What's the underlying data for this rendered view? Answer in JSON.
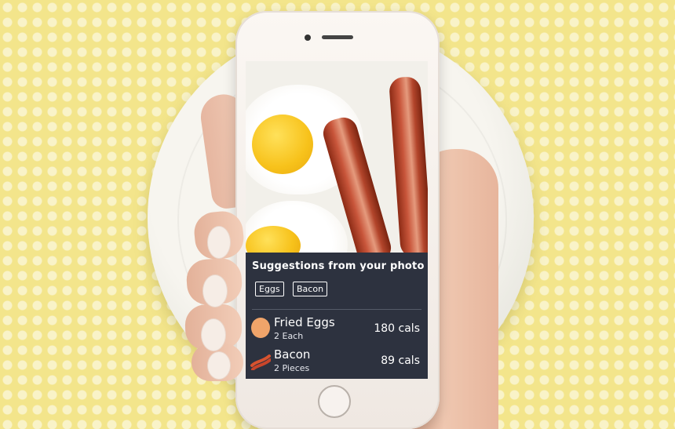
{
  "panel": {
    "title": "Suggestions from your photo",
    "tags": [
      "Eggs",
      "Bacon"
    ]
  },
  "foods": [
    {
      "name": "Fried Eggs",
      "quantity": "2 Each",
      "calories": "180 cals",
      "icon": "egg-icon"
    },
    {
      "name": "Bacon",
      "quantity": "2 Pieces",
      "calories": "89 cals",
      "icon": "bacon-icon"
    }
  ],
  "colors": {
    "panel_bg": "#2d323f",
    "tablecloth": "#f3e58b",
    "yolk": "#f7c21b",
    "bacon": "#b3452b"
  }
}
